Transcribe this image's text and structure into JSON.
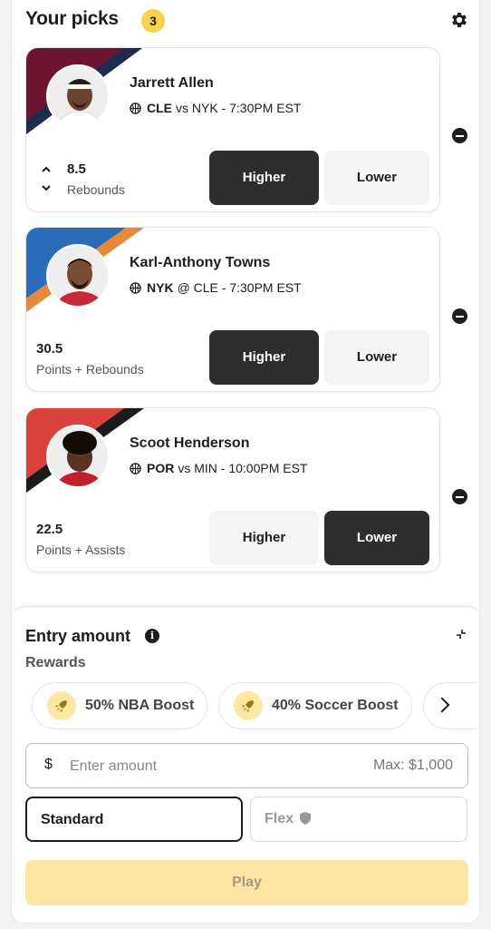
{
  "header": {
    "title": "Your picks",
    "count": "3"
  },
  "picks": [
    {
      "name": "Jarrett Allen",
      "team": "CLE",
      "matchup": "vs NYK - 7:30PM EST",
      "line": "8.5",
      "stat": "Rebounds",
      "higher_label": "Higher",
      "lower_label": "Lower",
      "selected": "higher",
      "colors": {
        "primary": "#6d1430",
        "secondary": "#1f2a4f"
      }
    },
    {
      "name": "Karl-Anthony Towns",
      "team": "NYK",
      "matchup": "@ CLE - 7:30PM EST",
      "line": "30.5",
      "stat": "Points + Rebounds",
      "higher_label": "Higher",
      "lower_label": "Lower",
      "selected": "higher",
      "colors": {
        "primary": "#2b6cb8",
        "secondary": "#e8893a"
      }
    },
    {
      "name": "Scoot Henderson",
      "team": "POR",
      "matchup": "vs MIN - 10:00PM EST",
      "line": "22.5",
      "stat": "Points + Assists",
      "higher_label": "Higher",
      "lower_label": "Lower",
      "selected": "lower",
      "colors": {
        "primary": "#d8413c",
        "secondary": "#1b1b1b"
      }
    }
  ],
  "entry": {
    "title": "Entry amount",
    "rewards_label": "Rewards",
    "rewards": [
      {
        "label": "50% NBA Boost"
      },
      {
        "label": "40% Soccer Boost"
      }
    ],
    "currency_symbol": "$",
    "amount_placeholder": "Enter amount",
    "max_label": "Max: $1,000",
    "modes": [
      {
        "label": "Standard",
        "selected": true
      },
      {
        "label": "Flex",
        "selected": false
      }
    ],
    "play_label": "Play"
  },
  "colors": {
    "accent": "#f7d24a",
    "dark": "#2e2e2e",
    "play_disabled": "#fbe6a3"
  }
}
